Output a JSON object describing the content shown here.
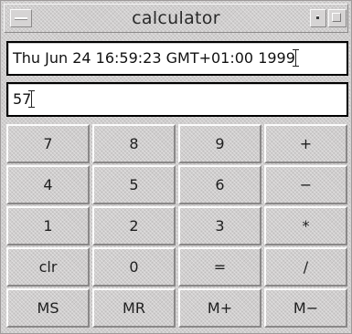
{
  "window": {
    "title": "calculator"
  },
  "date_field": {
    "value": "Thu Jun 24 16:59:23 GMT+01:00 1999"
  },
  "display": {
    "value": "57"
  },
  "keys": [
    {
      "label": "7"
    },
    {
      "label": "8"
    },
    {
      "label": "9"
    },
    {
      "label": "+"
    },
    {
      "label": "4"
    },
    {
      "label": "5"
    },
    {
      "label": "6"
    },
    {
      "label": "−"
    },
    {
      "label": "1"
    },
    {
      "label": "2"
    },
    {
      "label": "3"
    },
    {
      "label": "*"
    },
    {
      "label": "clr"
    },
    {
      "label": "0"
    },
    {
      "label": "="
    },
    {
      "label": "/"
    },
    {
      "label": "MS"
    },
    {
      "label": "MR"
    },
    {
      "label": "M+"
    },
    {
      "label": "M−"
    }
  ],
  "icons": {
    "window_menu": "window-menu-icon",
    "minimize": "minimize-icon",
    "maximize": "maximize-icon"
  }
}
